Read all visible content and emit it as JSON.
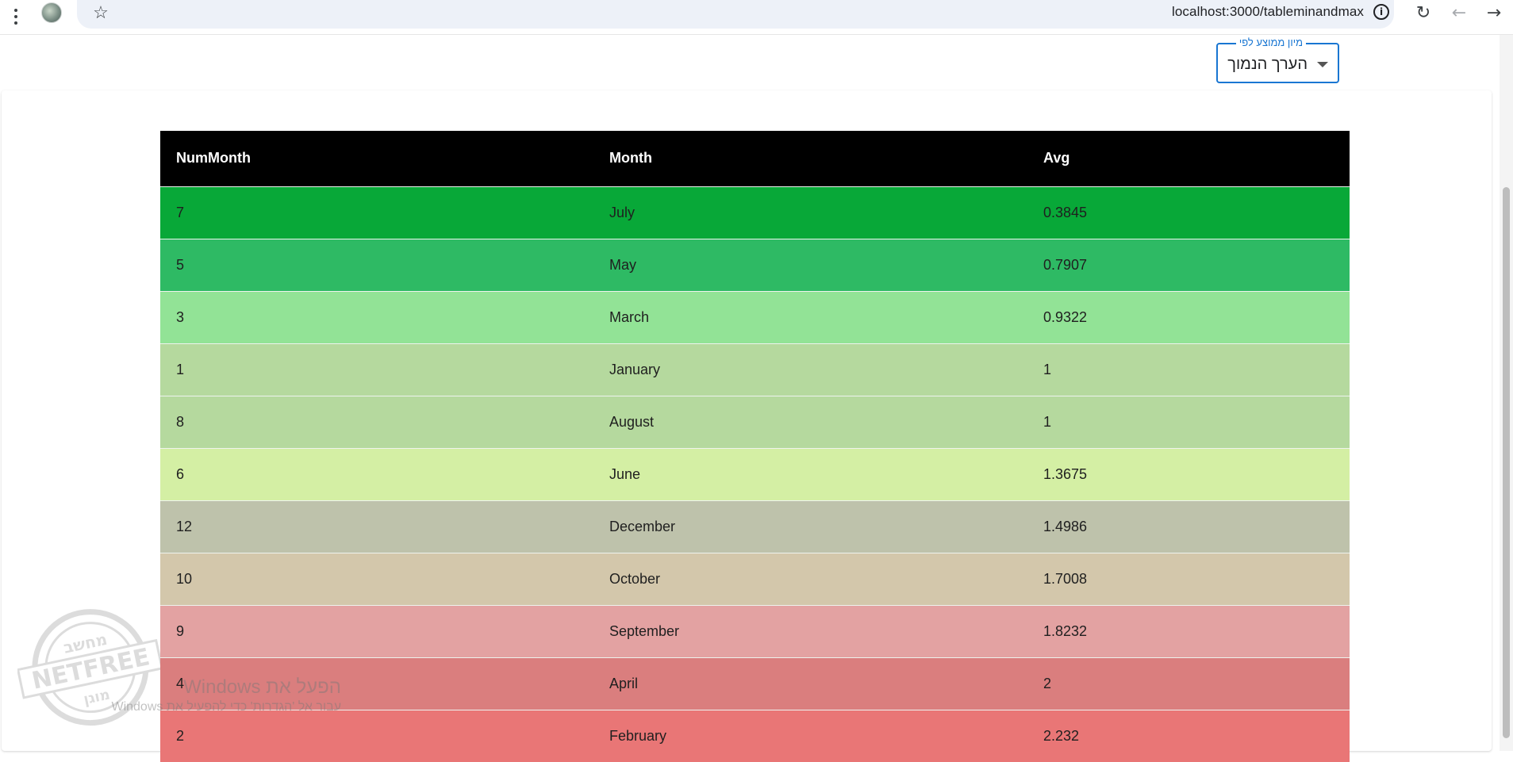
{
  "browser": {
    "url": "localhost:3000/tableminandmax",
    "icons": {
      "menu": "more-vert-icon",
      "site": "site-avatar-icon",
      "bookmark": "star-icon",
      "info": "info-icon",
      "reload": "reload-icon",
      "back": "back-arrow-icon",
      "forward": "forward-arrow-icon"
    }
  },
  "sort": {
    "label": "מיון ממוצע לפי",
    "selected": "הערך הנמוך",
    "accent_color": "#1976d2"
  },
  "table": {
    "headers": [
      "NumMonth",
      "Month",
      "Avg"
    ],
    "header_bg": "#000000",
    "rows": [
      {
        "num": "7",
        "month": "July",
        "avg": "0.3845",
        "color": "#08a838"
      },
      {
        "num": "5",
        "month": "May",
        "avg": "0.7907",
        "color": "#2eba64"
      },
      {
        "num": "3",
        "month": "March",
        "avg": "0.9322",
        "color": "#92e396"
      },
      {
        "num": "1",
        "month": "January",
        "avg": "1",
        "color": "#b5d99e"
      },
      {
        "num": "8",
        "month": "August",
        "avg": "1",
        "color": "#b5d99e"
      },
      {
        "num": "6",
        "month": "June",
        "avg": "1.3675",
        "color": "#d4efa4"
      },
      {
        "num": "12",
        "month": "December",
        "avg": "1.4986",
        "color": "#bec2ab"
      },
      {
        "num": "10",
        "month": "October",
        "avg": "1.7008",
        "color": "#d3c7ab"
      },
      {
        "num": "9",
        "month": "September",
        "avg": "1.8232",
        "color": "#e3a2a2"
      },
      {
        "num": "4",
        "month": "April",
        "avg": "2",
        "color": "#da7e7e"
      },
      {
        "num": "2",
        "month": "February",
        "avg": "2.232",
        "color": "#e97676"
      }
    ]
  },
  "watermarks": {
    "stamp_top": "מחשב",
    "stamp_middle": "NETFREE",
    "stamp_bottom": "מוגן",
    "windows_title": "הפעל את Windows",
    "windows_sub": "עבור אל 'הגדרות' כדי להפעיל את Windows"
  }
}
